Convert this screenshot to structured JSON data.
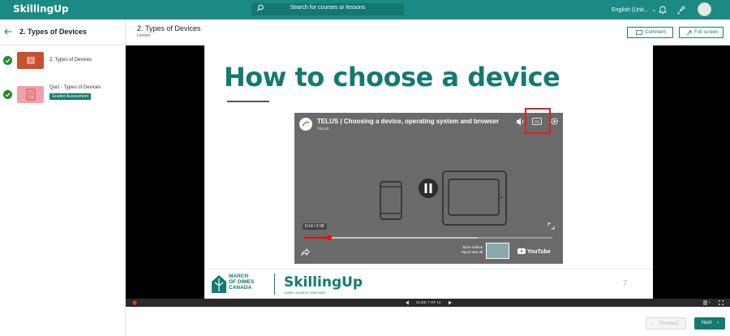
{
  "app": {
    "logo_text": "SkillingUp",
    "search_placeholder": "Search for courses or lessons",
    "language": "English (Unit...",
    "brand_color": "#1a8a82"
  },
  "sidebar": {
    "title": "2. Types of Devices",
    "items": [
      {
        "label": "2. Types of Devices",
        "thumb_color": "#c8502f",
        "status": "completed"
      },
      {
        "label": "Quiz - Types of Devices",
        "badge": "Graded Assessment",
        "thumb_color": "#f3a0a6",
        "status": "completed"
      }
    ]
  },
  "lesson": {
    "title": "2. Types of Devices",
    "type": "Lesson",
    "comment_label": "Comment",
    "fullscreen_label": "Full screen"
  },
  "slide": {
    "heading": "How to choose a device",
    "page_number": "7",
    "footer_org": [
      "MARCH",
      "OF DIMES",
      "CANADA"
    ],
    "footer_brand": "SkillingUp",
    "footer_tagline": "LEARN • ACHIEVE • EMPOWER"
  },
  "video": {
    "title": "TELUS | Choosing a device, operating system and browser",
    "channel": "TELUS",
    "time": "0:14 / 2:36",
    "progress": 0.1,
    "more_videos": "More videos",
    "more_videos_sub": "Tap to see all",
    "platform": "YouTube"
  },
  "player": {
    "slide_counter": "SLIDE 7 OF 14"
  },
  "nav": {
    "previous_label": "Previous",
    "next_label": "Next"
  }
}
